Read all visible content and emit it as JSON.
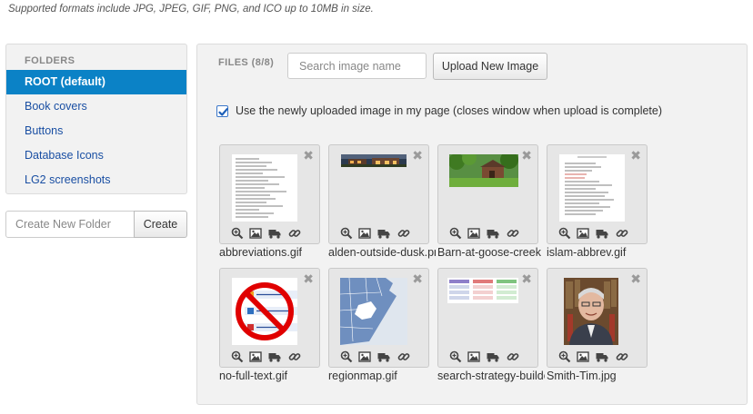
{
  "note": "Supported formats include JPG, JPEG, GIF, PNG, and ICO up to 10MB in size.",
  "sidebar": {
    "heading": "FOLDERS",
    "items": [
      {
        "label": "ROOT (default)",
        "active": true
      },
      {
        "label": "Book covers",
        "active": false
      },
      {
        "label": "Buttons",
        "active": false
      },
      {
        "label": "Database Icons",
        "active": false
      },
      {
        "label": "LG2 screenshots",
        "active": false
      }
    ]
  },
  "new_folder": {
    "placeholder": "Create New Folder",
    "create_label": "Create"
  },
  "files": {
    "heading": "FILES (8/8)",
    "search_placeholder": "Search image name",
    "upload_label": "Upload New Image",
    "use_uploaded_label": "Use the newly uploaded image in my page (closes window when upload is complete)",
    "use_uploaded_checked": true,
    "close_glyph": "✖",
    "items": [
      {
        "name": "abbreviations.gif",
        "thumb": "text-doc"
      },
      {
        "name": "alden-outside-dusk.png",
        "thumb": "dusk-building"
      },
      {
        "name": "Barn-at-goose-creek",
        "thumb": "barn"
      },
      {
        "name": "islam-abbrev.gif",
        "thumb": "text-doc-red"
      },
      {
        "name": "no-full-text.gif",
        "thumb": "no-symbol"
      },
      {
        "name": "regionmap.gif",
        "thumb": "map"
      },
      {
        "name": "search-strategy-builder",
        "thumb": "table-grid"
      },
      {
        "name": "Smith-Tim.jpg",
        "thumb": "portrait"
      }
    ]
  },
  "colors": {
    "accent": "#0b82c6",
    "link": "#1a4fa3",
    "no_symbol_red": "#e00000"
  }
}
